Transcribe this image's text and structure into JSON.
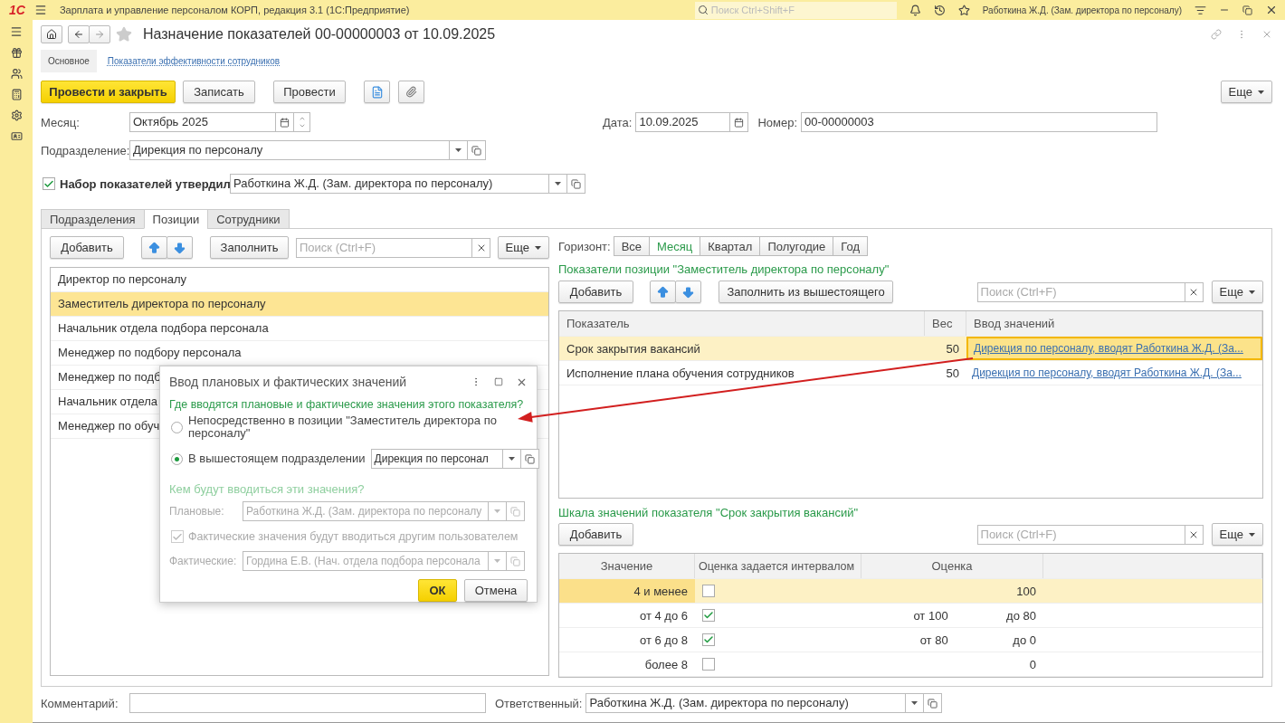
{
  "app": {
    "logo": "1С",
    "title": "Зарплата и управление персоналом КОРП, редакция 3.1  (1С:Предприятие)",
    "search": {
      "placeholder": "Поиск Ctrl+Shift+F"
    },
    "user": "Работкина Ж.Д. (Зам. директора по персоналу)"
  },
  "document": {
    "title": "Назначение показателей 00-00000003 от 10.09.2025"
  },
  "sections": [
    {
      "label": "Основное",
      "selected": true
    },
    {
      "label": "Показатели эффективности сотрудников",
      "selected": false
    }
  ],
  "commands": [
    {
      "label": "Провести и закрыть",
      "kind": "primary"
    },
    {
      "label": "Записать",
      "kind": "normal"
    },
    {
      "label": "Провести",
      "kind": "normal"
    }
  ],
  "commands_more": "Еще",
  "month": {
    "label": "Месяц:",
    "value": "Октябрь 2025"
  },
  "date": {
    "label": "Дата:",
    "value": "10.09.2025"
  },
  "number": {
    "label": "Номер:",
    "value": "00-00000003"
  },
  "department": {
    "label": "Подразделение:",
    "value": "Дирекция по персоналу"
  },
  "approved": {
    "label": "Набор показателей утвердил",
    "checked": true,
    "value": "Работкина Ж.Д. (Зам. директора по персоналу)"
  },
  "tabs": [
    {
      "label": "Подразделения",
      "selected": false
    },
    {
      "label": "Позиции",
      "selected": true
    },
    {
      "label": "Сотрудники",
      "selected": false
    }
  ],
  "positions": {
    "toolbar": {
      "add": "Добавить",
      "fill": "Заполнить",
      "search_placeholder": "Поиск (Ctrl+F)",
      "more": "Еще"
    },
    "rows": [
      {
        "label": "Директор по персоналу",
        "selected": false
      },
      {
        "label": "Заместитель директора по персоналу",
        "selected": true
      },
      {
        "label": "Начальник отдела подбора персонала",
        "selected": false
      },
      {
        "label": "Менеджер по подбору персонала",
        "selected": false
      },
      {
        "label": "Менеджер по подб",
        "selected": false
      },
      {
        "label": "Начальник отдела",
        "selected": false
      },
      {
        "label": "Менеджер по обуч",
        "selected": false
      }
    ]
  },
  "horizon": {
    "label": "Горизонт:",
    "options": [
      {
        "label": "Все",
        "selected": false
      },
      {
        "label": "Месяц",
        "selected": true
      },
      {
        "label": "Квартал",
        "selected": false
      },
      {
        "label": "Полугодие",
        "selected": false
      },
      {
        "label": "Год",
        "selected": false
      }
    ]
  },
  "indicators": {
    "title": "Показатели позиции \"Заместитель директора по персоналу\"",
    "toolbar": {
      "add": "Добавить",
      "fill": "Заполнить из вышестоящего",
      "search_placeholder": "Поиск (Ctrl+F)",
      "more": "Еще"
    },
    "columns": [
      "Показатель",
      "Вес",
      "Ввод значений"
    ],
    "rows": [
      {
        "name": "Срок закрытия вакансий",
        "weight": "50",
        "input": "Дирекция по персоналу, вводят Работкина Ж.Д. (За...",
        "selected": true
      },
      {
        "name": "Исполнение плана обучения сотрудников",
        "weight": "50",
        "input": "Дирекция по персоналу, вводят Работкина Ж.Д. (За...",
        "selected": false
      }
    ]
  },
  "scale": {
    "title": "Шкала значений показателя \"Срок закрытия вакансий\"",
    "toolbar": {
      "add": "Добавить",
      "search_placeholder": "Поиск (Ctrl+F)",
      "more": "Еще"
    },
    "columns": [
      "Значение",
      "Оценка задается интервалом",
      "Оценка"
    ],
    "rows": [
      {
        "value": "4 и менее",
        "interval": false,
        "score": "100",
        "selected": true
      },
      {
        "value": "от 4 до 6",
        "interval": true,
        "score_from": "от 100",
        "score_to": "до 80",
        "selected": false
      },
      {
        "value": "от 6 до 8",
        "interval": true,
        "score_from": "от 80",
        "score_to": "до 0",
        "selected": false
      },
      {
        "value": "более 8",
        "interval": false,
        "score": "0",
        "selected": false
      }
    ]
  },
  "dialog": {
    "title": "Ввод плановых и фактических значений",
    "question_where": "Где вводятся плановые и фактические значения этого показателя?",
    "options": [
      {
        "label": "Непосредственно в позиции \"Заместитель директора по персоналу\"",
        "selected": false
      },
      {
        "label": "В вышестоящем подразделении",
        "selected": true,
        "value": "Дирекция по персонал"
      }
    ],
    "question_who": "Кем будут вводиться эти значения?",
    "planned": {
      "label": "Плановые:",
      "value": "Работкина Ж.Д. (Зам. директора по персоналу",
      "disabled": true
    },
    "actual_check": {
      "label": "Фактические значения будут вводиться другим пользователем",
      "checked": true,
      "disabled": true
    },
    "actual": {
      "label": "Фактические:",
      "value": "Гордина Е.В. (Нач. отдела подбора персонала",
      "disabled": true
    },
    "ok": "ОК",
    "cancel": "Отмена"
  },
  "footer": {
    "comment_label": "Комментарий:",
    "responsible": {
      "label": "Ответственный:",
      "value": "Работкина Ж.Д. (Зам. директора по персоналу)"
    }
  }
}
